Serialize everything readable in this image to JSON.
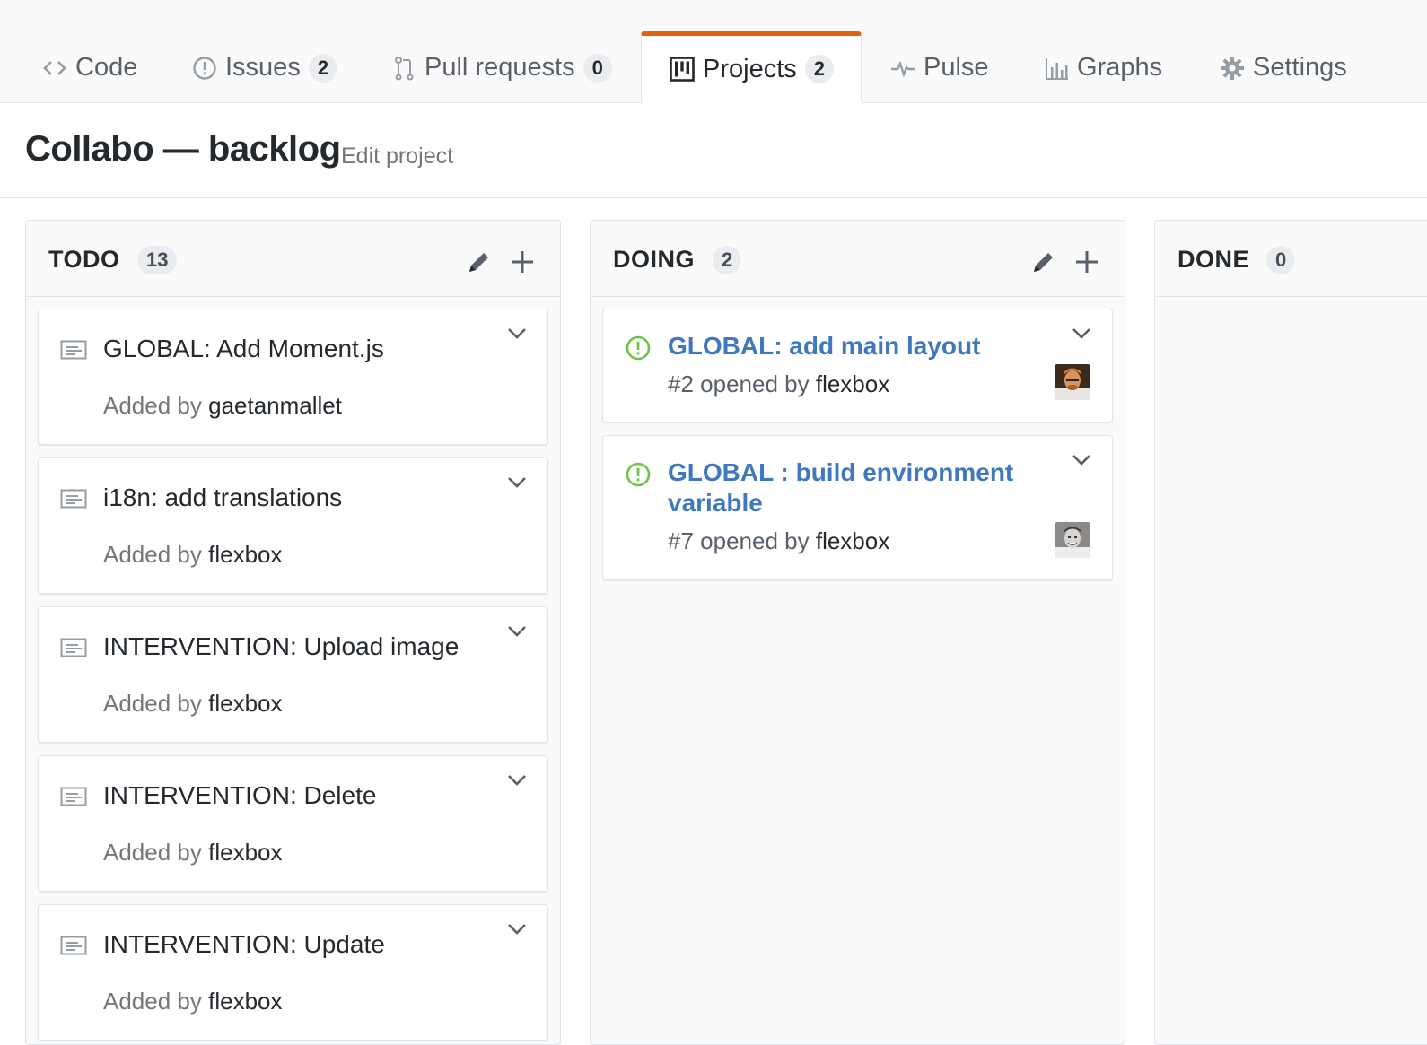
{
  "tabs": [
    {
      "label": "Code",
      "icon": "code-icon"
    },
    {
      "label": "Issues",
      "icon": "issue-opened-icon",
      "count": "2"
    },
    {
      "label": "Pull requests",
      "icon": "git-pull-request-icon",
      "count": "0"
    },
    {
      "label": "Projects",
      "icon": "project-icon",
      "count": "2",
      "selected": true
    },
    {
      "label": "Pulse",
      "icon": "pulse-icon"
    },
    {
      "label": "Graphs",
      "icon": "graph-icon"
    },
    {
      "label": "Settings",
      "icon": "gear-icon"
    }
  ],
  "accent_color": "#e36209",
  "project": {
    "title": "Collabo — backlog",
    "edit_label": "Edit project"
  },
  "columns": [
    {
      "name": "TODO",
      "count": "13",
      "cards": [
        {
          "title": "GLOBAL: Add Moment.js",
          "added_by_label": "Added by",
          "user": "gaetanmallet"
        },
        {
          "title": "i18n: add translations",
          "added_by_label": "Added by",
          "user": "flexbox"
        },
        {
          "title": "INTERVENTION: Upload image",
          "added_by_label": "Added by",
          "user": "flexbox"
        },
        {
          "title": "INTERVENTION: Delete",
          "added_by_label": "Added by",
          "user": "flexbox"
        },
        {
          "title": "INTERVENTION: Update",
          "added_by_label": "Added by",
          "user": "flexbox"
        }
      ]
    },
    {
      "name": "DOING",
      "count": "2",
      "cards": [
        {
          "title": "GLOBAL: add main layout",
          "number": "#2",
          "opened_label": "opened by",
          "user": "flexbox"
        },
        {
          "title": "GLOBAL : build environment variable",
          "number": "#7",
          "opened_label": "opened by",
          "user": "flexbox"
        }
      ]
    },
    {
      "name": "DONE",
      "count": "0",
      "cards": []
    }
  ],
  "issue_open_color": "#6cc644",
  "issue_link_color": "#4078c0"
}
